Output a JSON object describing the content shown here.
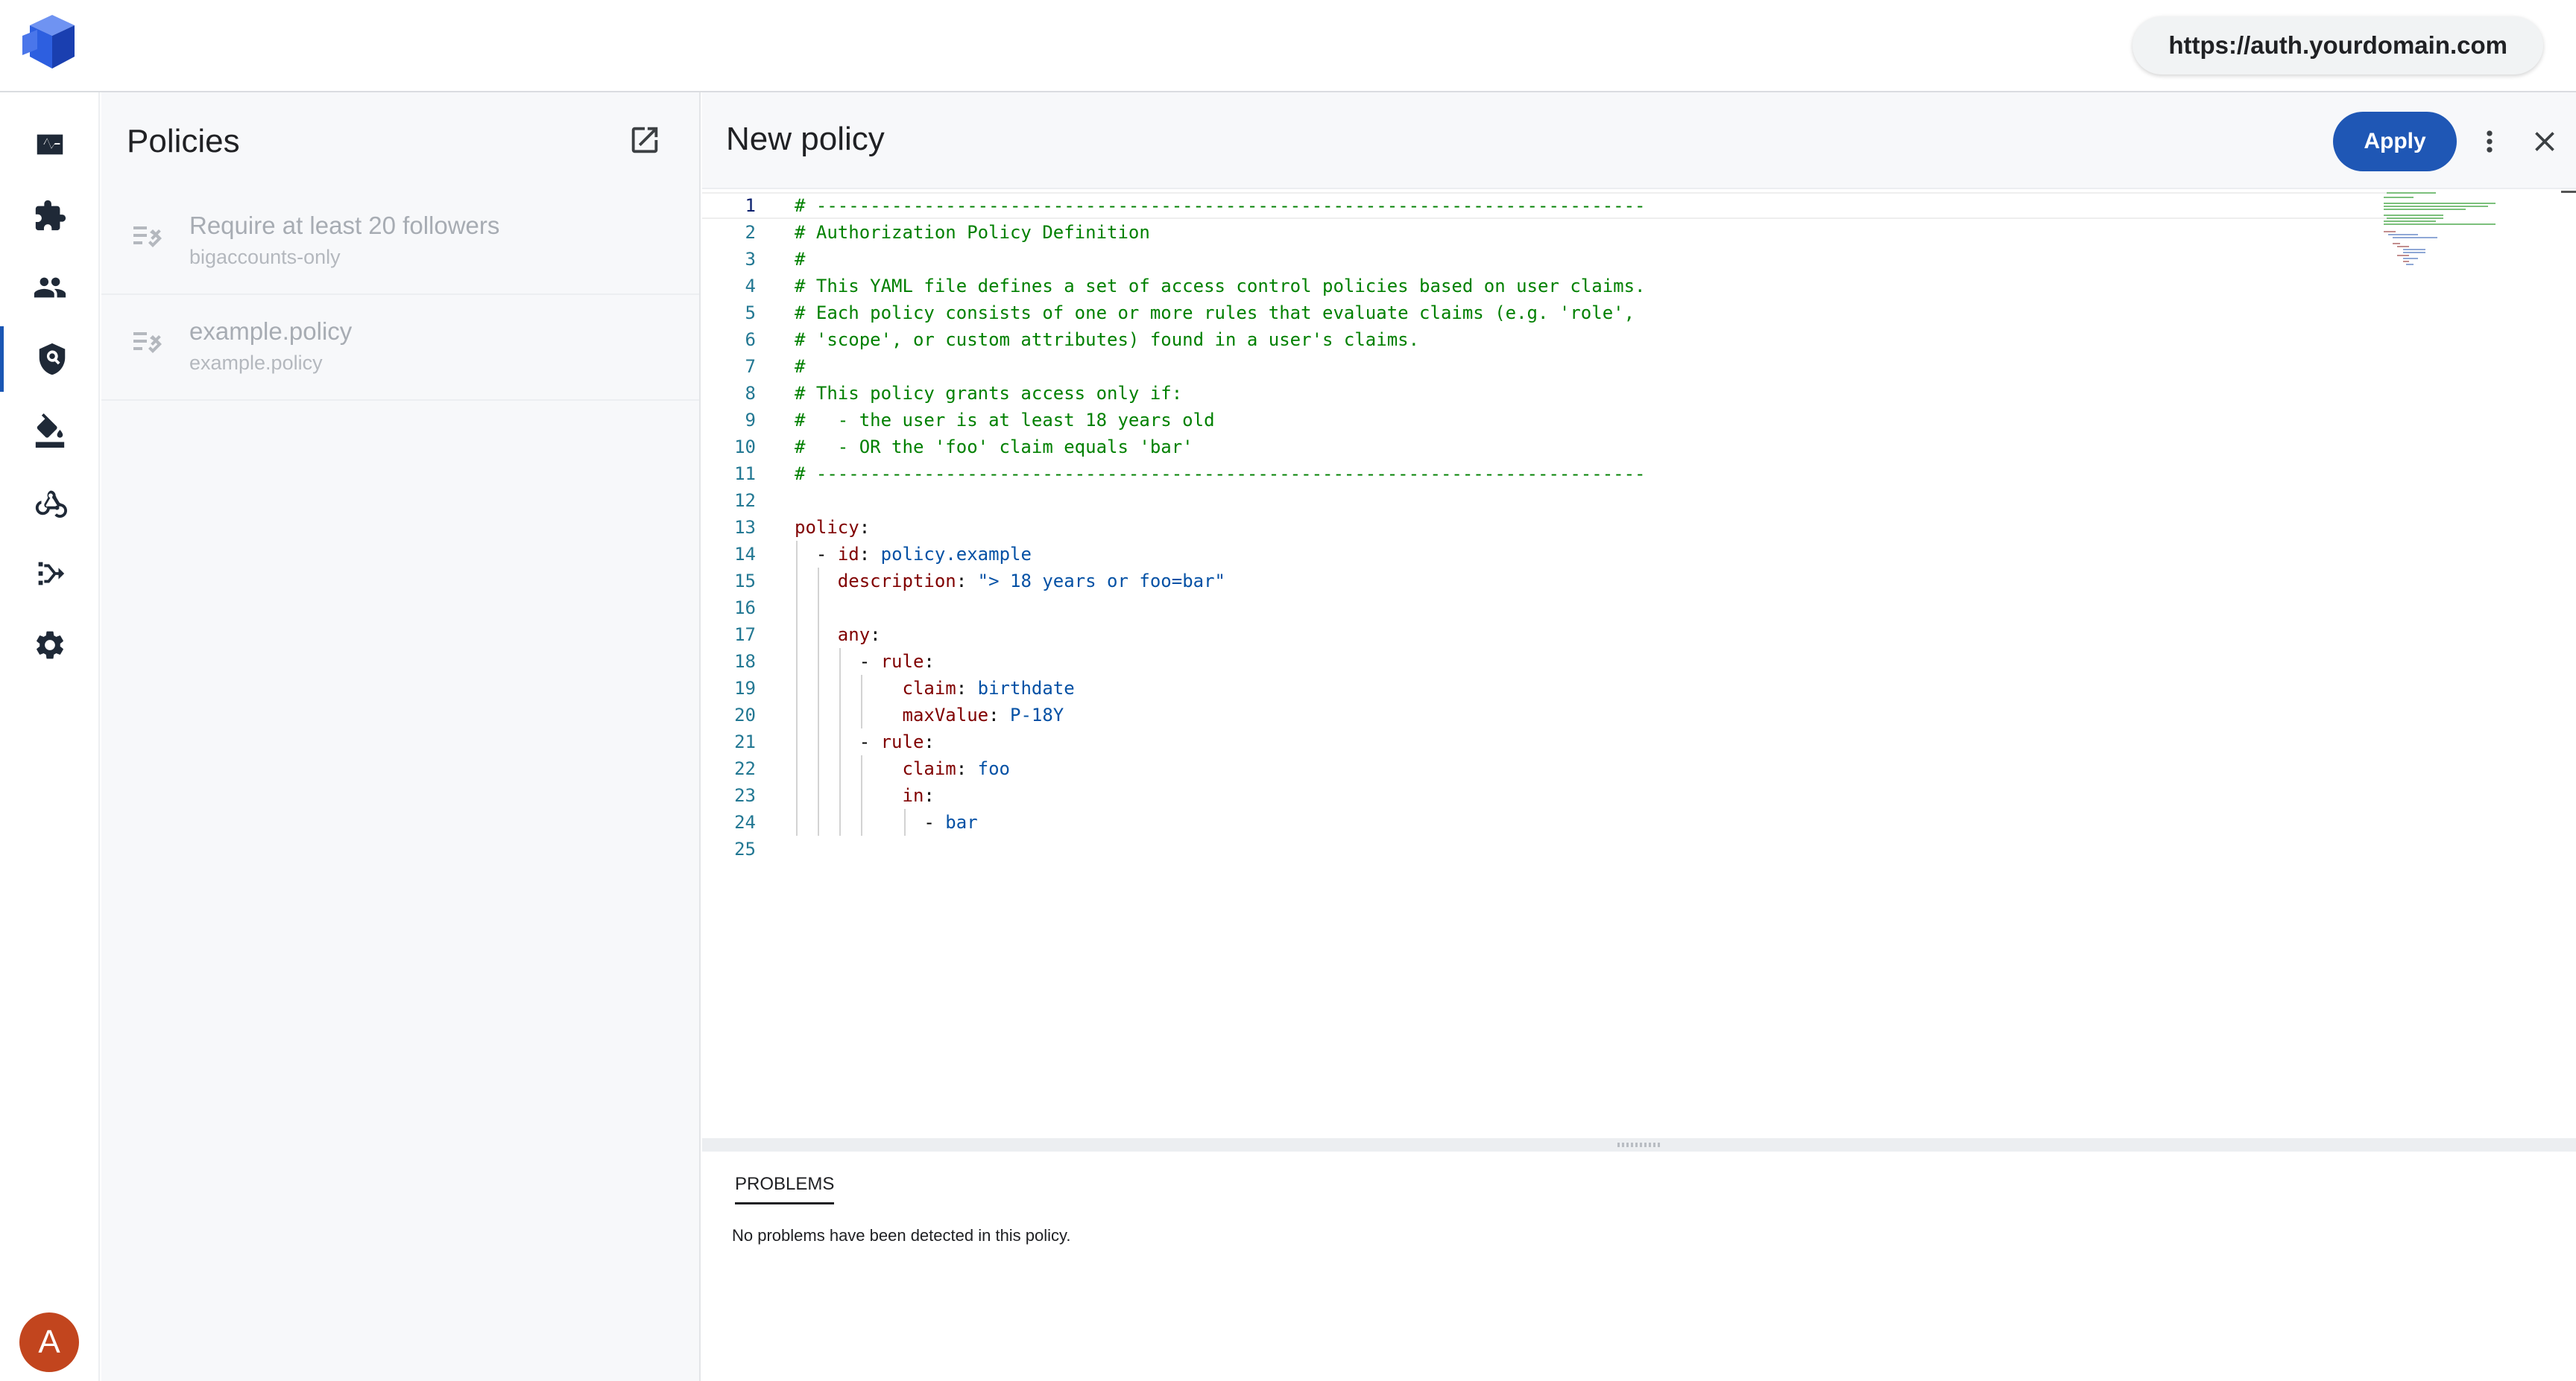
{
  "app": {
    "logo": "cube-logo-icon",
    "url": "https://auth.yourdomain.com",
    "accent": "#1f57b5",
    "avatar_initial": "A",
    "avatar_color": "#c2451e"
  },
  "nav": {
    "items": [
      {
        "icon": "activity-icon"
      },
      {
        "icon": "extension-icon"
      },
      {
        "icon": "users-icon"
      },
      {
        "icon": "policy-shield-icon",
        "active": true
      },
      {
        "icon": "branding-paint-icon"
      },
      {
        "icon": "webhook-icon"
      },
      {
        "icon": "flow-icon"
      },
      {
        "icon": "settings-gear-icon"
      }
    ]
  },
  "policies": {
    "title": "Policies",
    "items": [
      {
        "title": "Require at least 20 followers",
        "subtitle": "bigaccounts-only"
      },
      {
        "title": "example.policy",
        "subtitle": "example.policy"
      }
    ]
  },
  "editor": {
    "title": "New policy",
    "apply_label": "Apply",
    "current_line": 1,
    "lines": [
      "# -----------------------------------------------------------------------------",
      "# Authorization Policy Definition",
      "#",
      "# This YAML file defines a set of access control policies based on user claims.",
      "# Each policy consists of one or more rules that evaluate claims (e.g. 'role',",
      "# 'scope', or custom attributes) found in a user's claims.",
      "#",
      "# This policy grants access only if:",
      "#   - the user is at least 18 years old",
      "#   - OR the 'foo' claim equals 'bar'",
      "# -----------------------------------------------------------------------------",
      "",
      "policy:",
      "  - id: policy.example",
      "    description: \"> 18 years or foo=bar\"",
      "",
      "    any:",
      "      - rule:",
      "          claim: birthdate",
      "          maxValue: P-18Y",
      "      - rule:",
      "          claim: foo",
      "          in:",
      "            - bar",
      ""
    ]
  },
  "problems": {
    "tab_label": "PROBLEMS",
    "message": "No problems have been detected in this policy."
  }
}
